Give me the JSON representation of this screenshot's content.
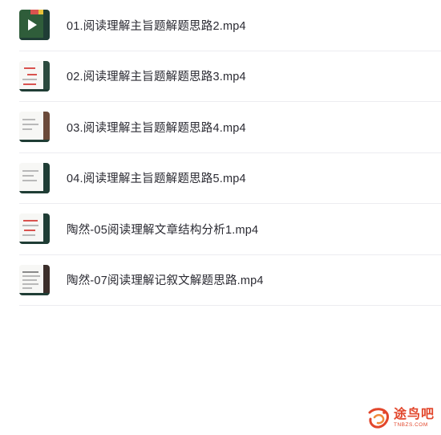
{
  "files": [
    {
      "name": "01.阅读理解主旨题解题思路2.mp4",
      "thumb_icon": "video-thumbnail-icon"
    },
    {
      "name": "02.阅读理解主旨题解题思路3.mp4",
      "thumb_icon": "video-thumbnail-icon"
    },
    {
      "name": "03.阅读理解主旨题解题思路4.mp4",
      "thumb_icon": "video-thumbnail-icon"
    },
    {
      "name": "04.阅读理解主旨题解题思路5.mp4",
      "thumb_icon": "video-thumbnail-icon"
    },
    {
      "name": "陶然-05阅读理解文章结构分析1.mp4",
      "thumb_icon": "video-thumbnail-icon"
    },
    {
      "name": "陶然-07阅读理解记叙文解题思路.mp4",
      "thumb_icon": "video-thumbnail-icon"
    }
  ],
  "watermark": {
    "title": "途鸟吧",
    "subtitle": "TNBZS.COM",
    "accent_color": "#e2462b"
  },
  "colors": {
    "text": "#2b2b33",
    "divider": "#ececf0",
    "thumb_dark": "#1f3d35"
  }
}
